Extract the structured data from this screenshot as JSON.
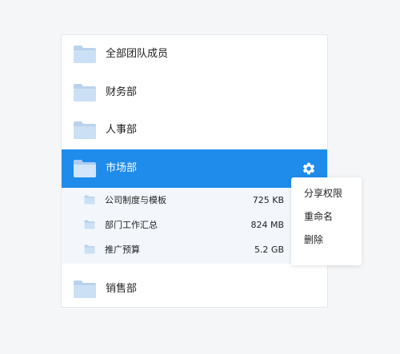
{
  "folders": [
    {
      "label": "全部团队成员"
    },
    {
      "label": "财务部"
    },
    {
      "label": "人事部"
    },
    {
      "label": "市场部"
    },
    {
      "label": "销售部"
    }
  ],
  "subfolders": [
    {
      "label": "公司制度与模板",
      "size": "725 KB"
    },
    {
      "label": "部门工作汇总",
      "size": "824 MB"
    },
    {
      "label": "推广预算",
      "size": "5.2 GB"
    }
  ],
  "context_menu": {
    "items": [
      "分享权限",
      "重命名",
      "删除"
    ]
  },
  "icons": {
    "folder": "folder-icon",
    "settings": "gear-icon"
  },
  "colors": {
    "accent": "#1f8ceb",
    "folder_fill": "#c6dcf1",
    "folder_tab": "#b5d0ea",
    "sub_bg": "#f3f7fc"
  }
}
